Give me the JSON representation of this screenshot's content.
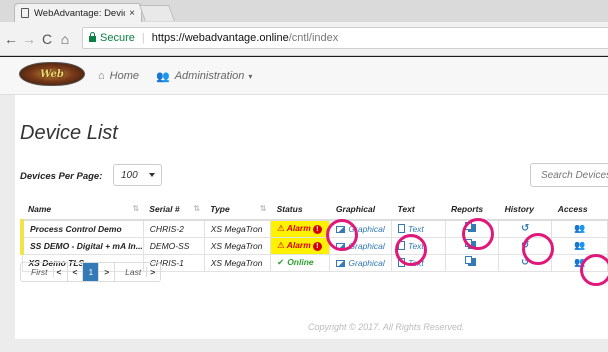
{
  "browser": {
    "tab_title": "WebAdvantage: Device L",
    "tab_close": "×",
    "secure_label": "Secure",
    "url_main": "https://webadvantage.online",
    "url_path": "/cntl/index"
  },
  "appnav": {
    "logo_text": "Web",
    "home_label": "Home",
    "admin_label": "Administration"
  },
  "page": {
    "title": "Device List",
    "per_page_label": "Devices Per Page:",
    "per_page_value": "100",
    "search_placeholder": "Search Devices",
    "copyright": "Copyright © 2017. All Rights Reserved."
  },
  "table": {
    "headers": [
      "Name",
      "Serial #",
      "Type",
      "Status",
      "Graphical",
      "Text",
      "Reports",
      "History",
      "Access"
    ],
    "rows": [
      {
        "name": "Process Control Demo",
        "serial": "CHRIS-2",
        "type": "XS MegaTron",
        "status": "Alarm",
        "graphical": "Graphical",
        "text": "Text"
      },
      {
        "name": "SS DEMO - Digital + mA In...",
        "serial": "DEMO-SS",
        "type": "XS MegaTron",
        "status": "Alarm",
        "graphical": "Graphical",
        "text": "Text"
      },
      {
        "name": "XS Demo TLS",
        "serial": "CHRIS-1",
        "type": "XS MegaTron",
        "status": "Online",
        "graphical": "Graphical",
        "text": "Text"
      }
    ]
  },
  "pager": {
    "first": "First",
    "current": "1",
    "last": "Last"
  },
  "colors": {
    "accent": "#337ab7",
    "alarm_bg": "#fff200",
    "alarm_text": "#d50000",
    "online": "#2e9e2e",
    "annotation": "#e0187a"
  }
}
